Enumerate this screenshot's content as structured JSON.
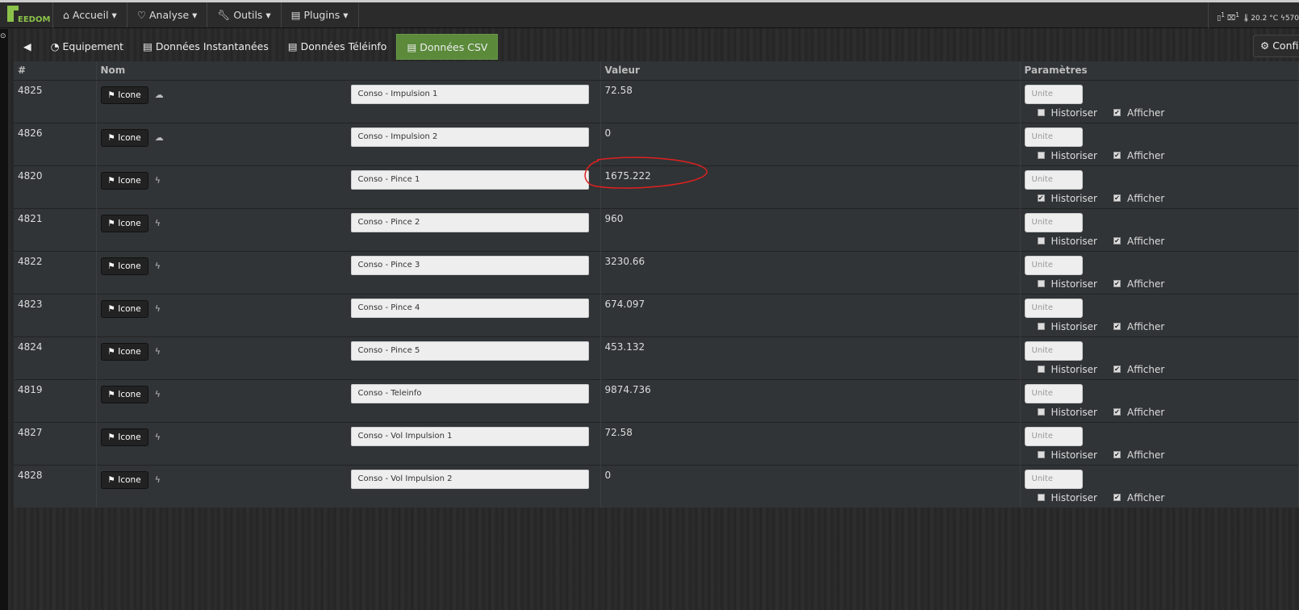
{
  "nav": {
    "logo": "EEDOM",
    "menus": [
      "Accueil ▾",
      "Analyse ▾",
      "Outils ▾",
      "Plugins ▾"
    ],
    "status": {
      "doors": "1",
      "windows": "1",
      "temperature": "20.2 °C",
      "power": "570"
    }
  },
  "tabs": [
    {
      "label": "Equipement"
    },
    {
      "label": "Données Instantanées"
    },
    {
      "label": "Données Téléinfo"
    },
    {
      "label": "Données CSV",
      "active": true
    }
  ],
  "config_label": "Config",
  "table": {
    "headers": [
      "#",
      "Nom",
      "Valeur",
      "Paramètres"
    ],
    "icon_button": "Icone",
    "unit_placeholder": "Unite",
    "historize_label": "Historiser",
    "display_label": "Afficher",
    "rows": [
      {
        "id": "4825",
        "icon": "cloud-icon",
        "name": "Conso - Impulsion 1",
        "value": "72.58",
        "historize": false,
        "display": true
      },
      {
        "id": "4826",
        "icon": "cloud-icon",
        "name": "Conso - Impulsion 2",
        "value": "0",
        "historize": false,
        "display": true
      },
      {
        "id": "4820",
        "icon": "bolt-icon",
        "name": "Conso - Pince 1",
        "value": "1675.222",
        "historize": true,
        "display": true
      },
      {
        "id": "4821",
        "icon": "bolt-icon",
        "name": "Conso - Pince 2",
        "value": "960",
        "historize": false,
        "display": true
      },
      {
        "id": "4822",
        "icon": "bolt-icon",
        "name": "Conso - Pince 3",
        "value": "3230.66",
        "historize": false,
        "display": true
      },
      {
        "id": "4823",
        "icon": "bolt-icon",
        "name": "Conso - Pince 4",
        "value": "674.097",
        "historize": false,
        "display": true
      },
      {
        "id": "4824",
        "icon": "bolt-icon",
        "name": "Conso - Pince 5",
        "value": "453.132",
        "historize": false,
        "display": true
      },
      {
        "id": "4819",
        "icon": "bolt-icon",
        "name": "Conso - Teleinfo",
        "value": "9874.736",
        "historize": false,
        "display": true
      },
      {
        "id": "4827",
        "icon": "bolt-icon",
        "name": "Conso - Vol Impulsion 1",
        "value": "72.58",
        "historize": false,
        "display": true
      },
      {
        "id": "4828",
        "icon": "bolt-icon",
        "name": "Conso - Vol Impulsion 2",
        "value": "0",
        "historize": false,
        "display": true
      }
    ]
  },
  "annotation_color": "#e02020"
}
